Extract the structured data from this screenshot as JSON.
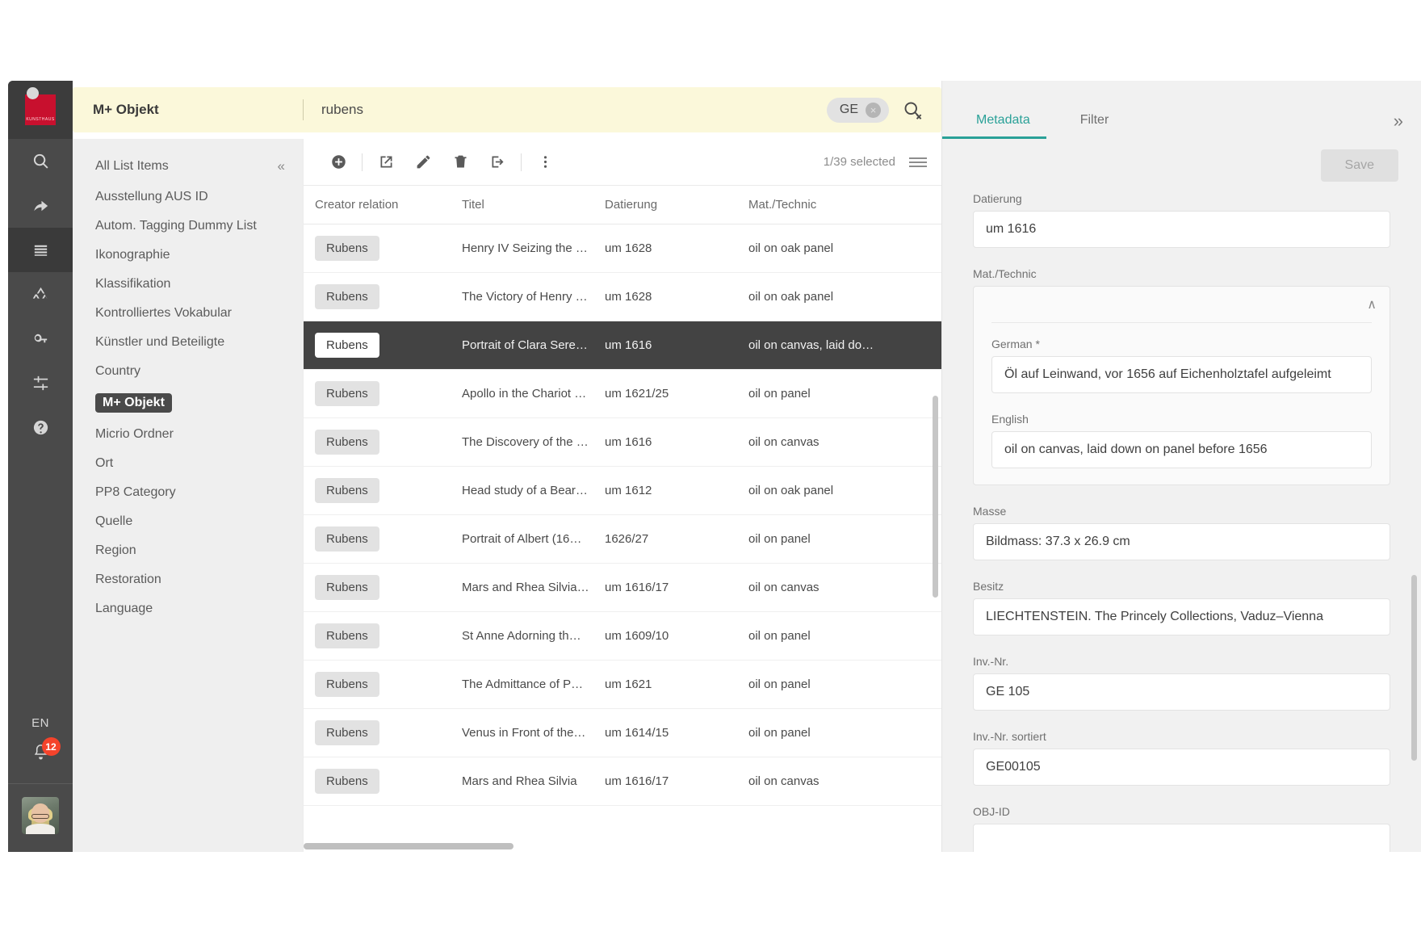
{
  "rail": {
    "logo_text": "KUNSTHAUS",
    "icons": [
      {
        "name": "search-icon",
        "label": "Search"
      },
      {
        "name": "share-icon",
        "label": "Share"
      },
      {
        "name": "list-icon",
        "label": "Lists",
        "active": true
      },
      {
        "name": "hierarchy-icon",
        "label": "Hierarchy"
      },
      {
        "name": "key-icon",
        "label": "Permissions"
      },
      {
        "name": "sliders-icon",
        "label": "Settings"
      },
      {
        "name": "help-icon",
        "label": "Help"
      }
    ],
    "language": "EN",
    "notification_count": "12"
  },
  "search": {
    "module": "M+ Objekt",
    "query": "rubens",
    "placeholder": "Search",
    "chip": "GE",
    "clear_chip": "×"
  },
  "tabs": {
    "items": [
      {
        "label": "Metadata",
        "active": true
      },
      {
        "label": "Filter",
        "active": false
      }
    ],
    "expand_icon": "»",
    "accent": "#2aa198"
  },
  "listnav": {
    "header": "All List Items",
    "collapse_icon": "«",
    "items": [
      {
        "label": "Ausstellung AUS ID",
        "active": false
      },
      {
        "label": "Autom. Tagging Dummy List",
        "active": false
      },
      {
        "label": "Ikonographie",
        "active": false
      },
      {
        "label": "Klassifikation",
        "active": false
      },
      {
        "label": "Kontrolliertes Vokabular",
        "active": false
      },
      {
        "label": "Künstler und Beteiligte",
        "active": false
      },
      {
        "label": "Country",
        "active": false
      },
      {
        "label": "M+ Objekt",
        "active": true
      },
      {
        "label": "Micrio Ordner",
        "active": false
      },
      {
        "label": "Ort",
        "active": false
      },
      {
        "label": "PP8 Category",
        "active": false
      },
      {
        "label": "Quelle",
        "active": false
      },
      {
        "label": "Region",
        "active": false
      },
      {
        "label": "Restoration",
        "active": false
      },
      {
        "label": "Language",
        "active": false
      }
    ]
  },
  "toolbar": {
    "buttons": [
      {
        "name": "add-button",
        "label": "Add"
      },
      {
        "name": "open-in-new-button",
        "label": "Open in new window"
      },
      {
        "name": "edit-button",
        "label": "Edit"
      },
      {
        "name": "delete-button",
        "label": "Delete"
      },
      {
        "name": "export-button",
        "label": "Export"
      },
      {
        "name": "more-options-button",
        "label": "More"
      }
    ],
    "selected_count": "1/39 selected"
  },
  "table": {
    "columns": [
      "Creator relation",
      "Titel",
      "Datierung",
      "Mat./Technic"
    ],
    "rows": [
      {
        "creator": "Rubens",
        "titel": "Henry IV Seizing the …",
        "datierung": "um 1628",
        "mat": "oil on oak panel",
        "selected": false
      },
      {
        "creator": "Rubens",
        "titel": "The Victory of Henry …",
        "datierung": "um 1628",
        "mat": "oil on oak panel",
        "selected": false
      },
      {
        "creator": "Rubens",
        "titel": "Portrait of Clara Sere…",
        "datierung": "um 1616",
        "mat": "oil on canvas, laid do…",
        "selected": true
      },
      {
        "creator": "Rubens",
        "titel": "Apollo in the Chariot …",
        "datierung": "um 1621/25",
        "mat": "oil on panel",
        "selected": false
      },
      {
        "creator": "Rubens",
        "titel": "The Discovery of the …",
        "datierung": "um 1616",
        "mat": "oil on canvas",
        "selected": false
      },
      {
        "creator": "Rubens",
        "titel": "Head study of a Bear…",
        "datierung": "um 1612",
        "mat": "oil on oak panel",
        "selected": false
      },
      {
        "creator": "Rubens",
        "titel": "Portrait of Albert (16…",
        "datierung": "1626/27",
        "mat": "oil on panel",
        "selected": false
      },
      {
        "creator": "Rubens",
        "titel": "Mars and Rhea Silvia…",
        "datierung": "um 1616/17",
        "mat": "oil on canvas",
        "selected": false
      },
      {
        "creator": "Rubens",
        "titel": "St Anne Adorning th…",
        "datierung": "um 1609/10",
        "mat": "oil on panel",
        "selected": false
      },
      {
        "creator": "Rubens",
        "titel": "The Admittance of P…",
        "datierung": "um 1621",
        "mat": "oil on panel",
        "selected": false
      },
      {
        "creator": "Rubens",
        "titel": "Venus in Front of the…",
        "datierung": "um 1614/15",
        "mat": "oil on panel",
        "selected": false
      },
      {
        "creator": "Rubens",
        "titel": "Mars and Rhea Silvia",
        "datierung": "um 1616/17",
        "mat": "oil on canvas",
        "selected": false
      }
    ]
  },
  "metadata": {
    "save_label": "Save",
    "datierung": {
      "label": "Datierung",
      "value": "um 1616"
    },
    "mat_technic": {
      "label": "Mat./Technic",
      "collapse_icon": "∧",
      "german": {
        "label": "German *",
        "value": "Öl auf Leinwand, vor 1656 auf Eichenholztafel aufgeleimt"
      },
      "english": {
        "label": "English",
        "value": "oil on canvas, laid down on panel before 1656"
      }
    },
    "masse": {
      "label": "Masse",
      "value": "Bildmass: 37.3 x 26.9 cm"
    },
    "besitz": {
      "label": "Besitz",
      "value": "LIECHTENSTEIN. The Princely Collections, Vaduz–Vienna"
    },
    "inv_nr": {
      "label": "Inv.-Nr.",
      "value": "GE 105"
    },
    "inv_nr_sortiert": {
      "label": "Inv.-Nr. sortiert",
      "value": "GE00105"
    },
    "obj_id": {
      "label": "OBJ-ID",
      "value": ""
    }
  }
}
